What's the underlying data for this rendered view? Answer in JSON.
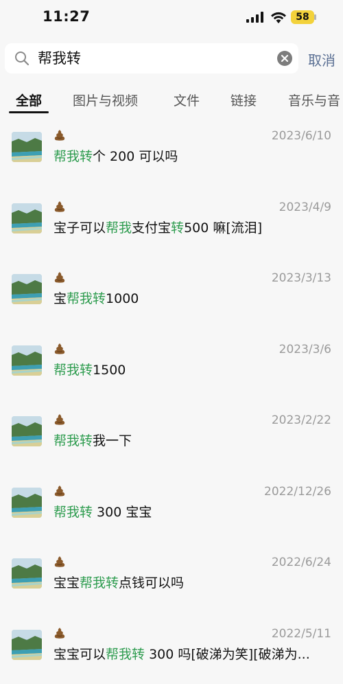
{
  "status": {
    "time": "11:27",
    "battery": "58"
  },
  "search": {
    "query": "帮我转",
    "cancel_label": "取消"
  },
  "tabs": [
    {
      "label": "全部"
    },
    {
      "label": "图片与视频"
    },
    {
      "label": "文件"
    },
    {
      "label": "链接"
    },
    {
      "label": "音乐与音"
    }
  ],
  "colors": {
    "highlight": "#2e9c4f",
    "cancel": "#5a6f93",
    "date": "#9a9a9a"
  },
  "results": [
    {
      "date": "2023/6/10",
      "segments": [
        {
          "t": "帮我转",
          "h": true
        },
        {
          "t": "个 200 可以吗",
          "h": false
        }
      ]
    },
    {
      "date": "2023/4/9",
      "segments": [
        {
          "t": "宝子可以",
          "h": false
        },
        {
          "t": "帮我",
          "h": true
        },
        {
          "t": "支付宝",
          "h": false
        },
        {
          "t": "转",
          "h": true
        },
        {
          "t": "500 嘛[流泪]",
          "h": false
        }
      ]
    },
    {
      "date": "2023/3/13",
      "segments": [
        {
          "t": "宝",
          "h": false
        },
        {
          "t": "帮我转",
          "h": true
        },
        {
          "t": "1000",
          "h": false
        }
      ]
    },
    {
      "date": "2023/3/6",
      "segments": [
        {
          "t": "帮我转",
          "h": true
        },
        {
          "t": "1500",
          "h": false
        }
      ]
    },
    {
      "date": "2023/2/22",
      "segments": [
        {
          "t": "帮我转",
          "h": true
        },
        {
          "t": "我一下",
          "h": false
        }
      ]
    },
    {
      "date": "2022/12/26",
      "segments": [
        {
          "t": "帮我转",
          "h": true
        },
        {
          "t": " 300 宝宝",
          "h": false
        }
      ]
    },
    {
      "date": "2022/6/24",
      "segments": [
        {
          "t": "宝宝",
          "h": false
        },
        {
          "t": "帮我转",
          "h": true
        },
        {
          "t": "点钱可以吗",
          "h": false
        }
      ]
    },
    {
      "date": "2022/5/11",
      "segments": [
        {
          "t": "宝宝可以",
          "h": false
        },
        {
          "t": "帮我转",
          "h": true
        },
        {
          "t": " 300 吗[破涕为笑][破涕为...",
          "h": false
        }
      ]
    }
  ]
}
